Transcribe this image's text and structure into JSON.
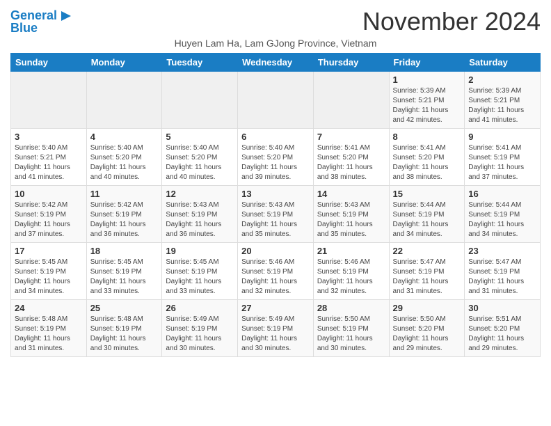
{
  "header": {
    "logo_line1": "General",
    "logo_line2": "Blue",
    "month_title": "November 2024",
    "subtitle": "Huyen Lam Ha, Lam GJong Province, Vietnam"
  },
  "days_of_week": [
    "Sunday",
    "Monday",
    "Tuesday",
    "Wednesday",
    "Thursday",
    "Friday",
    "Saturday"
  ],
  "weeks": [
    [
      {
        "day": "",
        "info": ""
      },
      {
        "day": "",
        "info": ""
      },
      {
        "day": "",
        "info": ""
      },
      {
        "day": "",
        "info": ""
      },
      {
        "day": "",
        "info": ""
      },
      {
        "day": "1",
        "info": "Sunrise: 5:39 AM\nSunset: 5:21 PM\nDaylight: 11 hours and 42 minutes."
      },
      {
        "day": "2",
        "info": "Sunrise: 5:39 AM\nSunset: 5:21 PM\nDaylight: 11 hours and 41 minutes."
      }
    ],
    [
      {
        "day": "3",
        "info": "Sunrise: 5:40 AM\nSunset: 5:21 PM\nDaylight: 11 hours and 41 minutes."
      },
      {
        "day": "4",
        "info": "Sunrise: 5:40 AM\nSunset: 5:20 PM\nDaylight: 11 hours and 40 minutes."
      },
      {
        "day": "5",
        "info": "Sunrise: 5:40 AM\nSunset: 5:20 PM\nDaylight: 11 hours and 40 minutes."
      },
      {
        "day": "6",
        "info": "Sunrise: 5:40 AM\nSunset: 5:20 PM\nDaylight: 11 hours and 39 minutes."
      },
      {
        "day": "7",
        "info": "Sunrise: 5:41 AM\nSunset: 5:20 PM\nDaylight: 11 hours and 38 minutes."
      },
      {
        "day": "8",
        "info": "Sunrise: 5:41 AM\nSunset: 5:20 PM\nDaylight: 11 hours and 38 minutes."
      },
      {
        "day": "9",
        "info": "Sunrise: 5:41 AM\nSunset: 5:19 PM\nDaylight: 11 hours and 37 minutes."
      }
    ],
    [
      {
        "day": "10",
        "info": "Sunrise: 5:42 AM\nSunset: 5:19 PM\nDaylight: 11 hours and 37 minutes."
      },
      {
        "day": "11",
        "info": "Sunrise: 5:42 AM\nSunset: 5:19 PM\nDaylight: 11 hours and 36 minutes."
      },
      {
        "day": "12",
        "info": "Sunrise: 5:43 AM\nSunset: 5:19 PM\nDaylight: 11 hours and 36 minutes."
      },
      {
        "day": "13",
        "info": "Sunrise: 5:43 AM\nSunset: 5:19 PM\nDaylight: 11 hours and 35 minutes."
      },
      {
        "day": "14",
        "info": "Sunrise: 5:43 AM\nSunset: 5:19 PM\nDaylight: 11 hours and 35 minutes."
      },
      {
        "day": "15",
        "info": "Sunrise: 5:44 AM\nSunset: 5:19 PM\nDaylight: 11 hours and 34 minutes."
      },
      {
        "day": "16",
        "info": "Sunrise: 5:44 AM\nSunset: 5:19 PM\nDaylight: 11 hours and 34 minutes."
      }
    ],
    [
      {
        "day": "17",
        "info": "Sunrise: 5:45 AM\nSunset: 5:19 PM\nDaylight: 11 hours and 34 minutes."
      },
      {
        "day": "18",
        "info": "Sunrise: 5:45 AM\nSunset: 5:19 PM\nDaylight: 11 hours and 33 minutes."
      },
      {
        "day": "19",
        "info": "Sunrise: 5:45 AM\nSunset: 5:19 PM\nDaylight: 11 hours and 33 minutes."
      },
      {
        "day": "20",
        "info": "Sunrise: 5:46 AM\nSunset: 5:19 PM\nDaylight: 11 hours and 32 minutes."
      },
      {
        "day": "21",
        "info": "Sunrise: 5:46 AM\nSunset: 5:19 PM\nDaylight: 11 hours and 32 minutes."
      },
      {
        "day": "22",
        "info": "Sunrise: 5:47 AM\nSunset: 5:19 PM\nDaylight: 11 hours and 31 minutes."
      },
      {
        "day": "23",
        "info": "Sunrise: 5:47 AM\nSunset: 5:19 PM\nDaylight: 11 hours and 31 minutes."
      }
    ],
    [
      {
        "day": "24",
        "info": "Sunrise: 5:48 AM\nSunset: 5:19 PM\nDaylight: 11 hours and 31 minutes."
      },
      {
        "day": "25",
        "info": "Sunrise: 5:48 AM\nSunset: 5:19 PM\nDaylight: 11 hours and 30 minutes."
      },
      {
        "day": "26",
        "info": "Sunrise: 5:49 AM\nSunset: 5:19 PM\nDaylight: 11 hours and 30 minutes."
      },
      {
        "day": "27",
        "info": "Sunrise: 5:49 AM\nSunset: 5:19 PM\nDaylight: 11 hours and 30 minutes."
      },
      {
        "day": "28",
        "info": "Sunrise: 5:50 AM\nSunset: 5:19 PM\nDaylight: 11 hours and 30 minutes."
      },
      {
        "day": "29",
        "info": "Sunrise: 5:50 AM\nSunset: 5:20 PM\nDaylight: 11 hours and 29 minutes."
      },
      {
        "day": "30",
        "info": "Sunrise: 5:51 AM\nSunset: 5:20 PM\nDaylight: 11 hours and 29 minutes."
      }
    ]
  ]
}
